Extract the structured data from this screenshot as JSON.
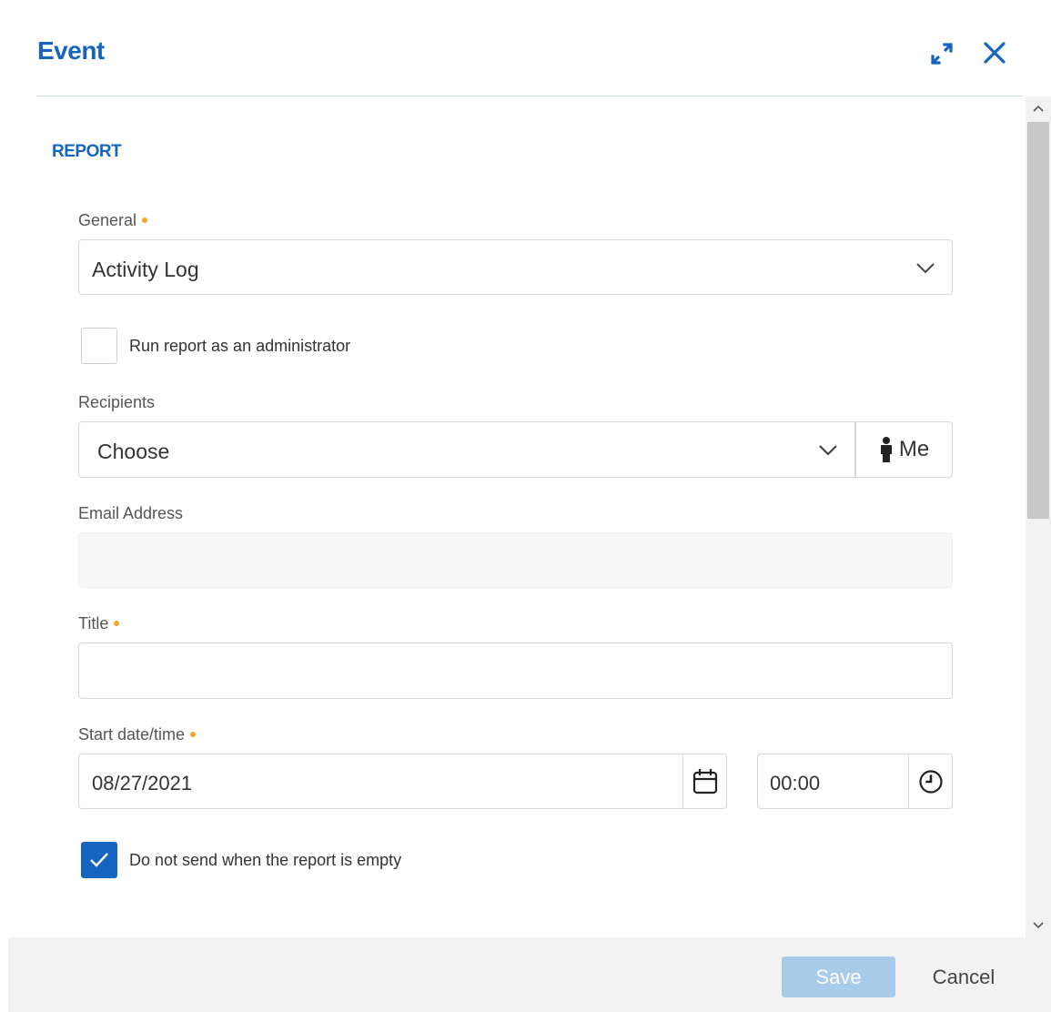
{
  "header": {
    "title": "Event"
  },
  "section": {
    "title": "REPORT"
  },
  "form": {
    "general": {
      "label": "General",
      "value": "Activity Log",
      "required": true
    },
    "run_as_admin": {
      "label": "Run report as an administrator",
      "checked": false
    },
    "recipients": {
      "label": "Recipients",
      "value": "Choose",
      "me_label": "Me"
    },
    "email": {
      "label": "Email Address",
      "value": ""
    },
    "title": {
      "label": "Title",
      "value": "",
      "required": true
    },
    "start": {
      "label": "Start date/time",
      "date": "08/27/2021",
      "time": "00:00",
      "required": true
    },
    "skip_empty": {
      "label": "Do not send when the report is empty",
      "checked": true
    }
  },
  "footer": {
    "save_label": "Save",
    "cancel_label": "Cancel"
  },
  "icons": {
    "expand": "expand-icon",
    "close": "close-icon",
    "chevron": "chevron-down-icon",
    "person": "person-icon",
    "calendar": "calendar-icon",
    "clock": "clock-icon",
    "check": "checkmark-icon"
  },
  "colors": {
    "accent": "#1565c0",
    "required_dot": "#f5a623",
    "save_disabled": "#a9cbea"
  }
}
